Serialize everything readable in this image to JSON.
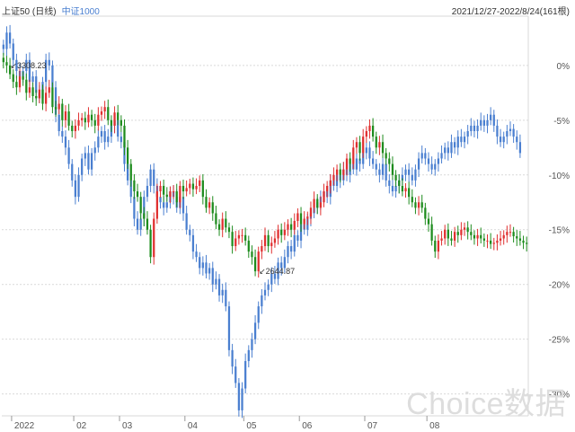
{
  "header": {
    "series1_label": "上证50 (日线)",
    "series2_label": "中证1000",
    "date_range": "2021/12/27-2022/8/24(161根)"
  },
  "watermark": "Choice数据",
  "colors": {
    "up": "#e03030",
    "down": "#1e8c1e",
    "series2": "#4a7fd0",
    "grid": "#d9d9d9",
    "axis_text": "#555555"
  },
  "chart_data": {
    "type": "candlestick",
    "ylabel": "",
    "ylim": [
      -32,
      4.5
    ],
    "y_ticks": [
      0,
      -5,
      -10,
      -15,
      -20,
      -25,
      -30
    ],
    "y_tick_labels": [
      "0%",
      "-5%",
      "-10%",
      "-15%",
      "-20%",
      "-25%",
      "-30%"
    ],
    "x_tick_labels": [
      "2022",
      "02",
      "03",
      "04",
      "05",
      "06",
      "07",
      "08"
    ],
    "x_tick_index": [
      3,
      22,
      36,
      56,
      74,
      91,
      111,
      130
    ],
    "annotations": [
      {
        "text": "3308.23",
        "point_index": 1,
        "value": 0.0
      },
      {
        "text": "2644.87",
        "point_index": 77,
        "value": -18.8
      }
    ],
    "series": [
      {
        "name": "上证50",
        "close": [
          0.3,
          0.0,
          -0.8,
          -1.5,
          -2.0,
          -1.0,
          -1.3,
          -2.5,
          -2.0,
          -2.8,
          -3.0,
          -2.2,
          -3.5,
          -2.5,
          -2.0,
          -3.8,
          -4.0,
          -3.5,
          -5.0,
          -4.2,
          -5.5,
          -6.0,
          -5.5,
          -5.0,
          -4.8,
          -5.2,
          -4.5,
          -5.0,
          -5.5,
          -4.5,
          -4.2,
          -3.8,
          -5.0,
          -5.5,
          -4.3,
          -5.0,
          -5.5,
          -7.5,
          -9.0,
          -10.5,
          -11.5,
          -12.0,
          -13.5,
          -14.0,
          -15.0,
          -17.5,
          -14.0,
          -11.5,
          -11.0,
          -11.8,
          -12.0,
          -11.5,
          -11.5,
          -12.5,
          -11.0,
          -11.5,
          -11.2,
          -10.8,
          -11.3,
          -11.0,
          -10.5,
          -12.0,
          -13.0,
          -12.5,
          -13.5,
          -14.5,
          -15.0,
          -14.0,
          -14.8,
          -15.2,
          -16.5,
          -15.8,
          -15.5,
          -15.5,
          -16.0,
          -17.0,
          -17.5,
          -18.8,
          -17.0,
          -16.5,
          -15.5,
          -16.5,
          -16.2,
          -15.8,
          -15.0,
          -15.5,
          -15.0,
          -14.5,
          -15.0,
          -14.2,
          -13.5,
          -14.5,
          -14.0,
          -13.8,
          -13.0,
          -12.2,
          -13.0,
          -12.5,
          -11.5,
          -11.0,
          -10.5,
          -10.0,
          -9.5,
          -10.0,
          -9.5,
          -8.5,
          -9.0,
          -7.5,
          -7.0,
          -8.0,
          -6.5,
          -6.0,
          -5.5,
          -6.5,
          -7.5,
          -7.0,
          -8.0,
          -8.5,
          -9.0,
          -10.0,
          -10.5,
          -11.0,
          -11.5,
          -11.2,
          -12.0,
          -12.5,
          -13.0,
          -12.5,
          -13.0,
          -14.0,
          -14.5,
          -16.0,
          -17.0,
          -16.0,
          -15.8,
          -15.0,
          -15.8,
          -16.0,
          -15.2,
          -15.5,
          -15.0,
          -14.8,
          -15.2,
          -15.5,
          -15.8,
          -15.5,
          -15.8,
          -16.0,
          -16.0,
          -16.3,
          -16.2,
          -16.0,
          -15.8,
          -15.5,
          -15.2,
          -15.2,
          -15.6,
          -15.8,
          -16.0,
          -16.2,
          -16.3
        ]
      },
      {
        "name": "中证1000",
        "close": [
          1.5,
          3.0,
          2.0,
          0.5,
          -0.5,
          -1.0,
          -0.5,
          0.5,
          -1.5,
          -1.0,
          -2.5,
          -3.0,
          -1.5,
          0.5,
          0.0,
          -2.0,
          -4.5,
          -6.0,
          -6.5,
          -7.5,
          -9.0,
          -10.5,
          -12.0,
          -10.0,
          -8.5,
          -8.0,
          -9.5,
          -8.0,
          -7.5,
          -6.5,
          -6.0,
          -7.0,
          -6.5,
          -5.5,
          -5.0,
          -6.5,
          -7.0,
          -9.0,
          -10.5,
          -12.0,
          -14.0,
          -15.0,
          -14.0,
          -12.0,
          -11.0,
          -9.5,
          -11.0,
          -12.0,
          -12.5,
          -13.0,
          -12.5,
          -11.5,
          -12.0,
          -13.0,
          -12.0,
          -13.5,
          -15.0,
          -15.5,
          -17.0,
          -17.5,
          -18.5,
          -18.0,
          -19.0,
          -18.5,
          -20.0,
          -19.5,
          -21.0,
          -20.5,
          -22.0,
          -26.0,
          -27.5,
          -29.0,
          -31.5,
          -29.5,
          -27.0,
          -26.0,
          -25.0,
          -23.5,
          -22.0,
          -21.0,
          -20.5,
          -20.0,
          -19.0,
          -19.5,
          -18.0,
          -18.5,
          -17.5,
          -16.5,
          -17.0,
          -15.5,
          -16.0,
          -14.5,
          -15.0,
          -14.0,
          -13.5,
          -13.0,
          -12.5,
          -12.0,
          -11.5,
          -12.0,
          -10.5,
          -11.0,
          -10.0,
          -10.5,
          -9.5,
          -10.0,
          -9.0,
          -9.5,
          -8.5,
          -9.0,
          -8.0,
          -7.5,
          -8.5,
          -9.0,
          -9.5,
          -10.0,
          -9.0,
          -10.5,
          -11.0,
          -11.5,
          -11.0,
          -10.5,
          -10.0,
          -9.5,
          -10.0,
          -10.5,
          -9.5,
          -8.5,
          -8.0,
          -8.5,
          -9.0,
          -9.5,
          -9.0,
          -8.5,
          -8.0,
          -7.5,
          -8.0,
          -7.0,
          -7.5,
          -6.5,
          -7.0,
          -6.5,
          -6.0,
          -5.5,
          -6.0,
          -5.5,
          -5.0,
          -5.5,
          -5.0,
          -4.5,
          -5.5,
          -6.5,
          -7.0,
          -6.5,
          -6.0,
          -5.8,
          -6.5,
          -7.0,
          -8.0
        ]
      }
    ]
  }
}
